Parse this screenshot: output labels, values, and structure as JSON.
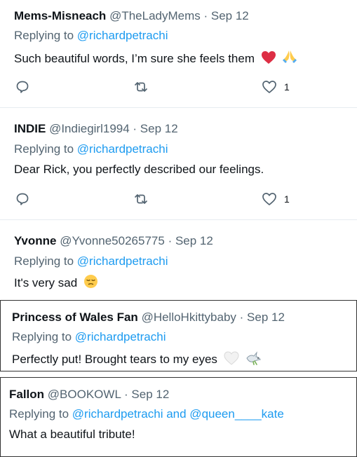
{
  "replies": [
    {
      "name": "Mems-Misneach",
      "handle": "@TheLadyMems",
      "date": "· Sep 12",
      "replying_prefix": "Replying to",
      "replying_to": "@richardpetrachi",
      "text": "Such beautiful words, I’m sure she feels them",
      "emojis": [
        "red-heart",
        "folded-hands"
      ],
      "like_count": "1"
    },
    {
      "name": "INDIE",
      "handle": "@Indiegirl1994",
      "date": "· Sep 12",
      "replying_prefix": "Replying to",
      "replying_to": "@richardpetrachi",
      "text": "Dear Rick, you perfectly described our feelings.",
      "like_count": "1"
    },
    {
      "name": "Yvonne",
      "handle": "@Yvonne50265775",
      "date": "· Sep 12",
      "replying_prefix": "Replying to",
      "replying_to": "@richardpetrachi",
      "text": "It's very sad",
      "emojis": [
        "relieved-face"
      ]
    },
    {
      "name": "Princess of Wales Fan",
      "handle": "@HelloHkittybaby",
      "date": "· Sep 12",
      "replying_prefix": "Replying to",
      "replying_to": "@richardpetrachi",
      "text": "Perfectly put! Brought tears to my eyes",
      "emojis": [
        "white-heart",
        "dove"
      ]
    },
    {
      "name": "Fallon",
      "handle": "@BOOKOWL",
      "date": "· Sep 12",
      "replying_prefix": "Replying to",
      "replying_to": "@richardpetrachi and @queen____kate",
      "text": "What a beautiful tribute!"
    }
  ],
  "colors": {
    "link": "#1d9bf0",
    "muted": "#536471",
    "text": "#0f1419",
    "card_border": "#333333"
  }
}
